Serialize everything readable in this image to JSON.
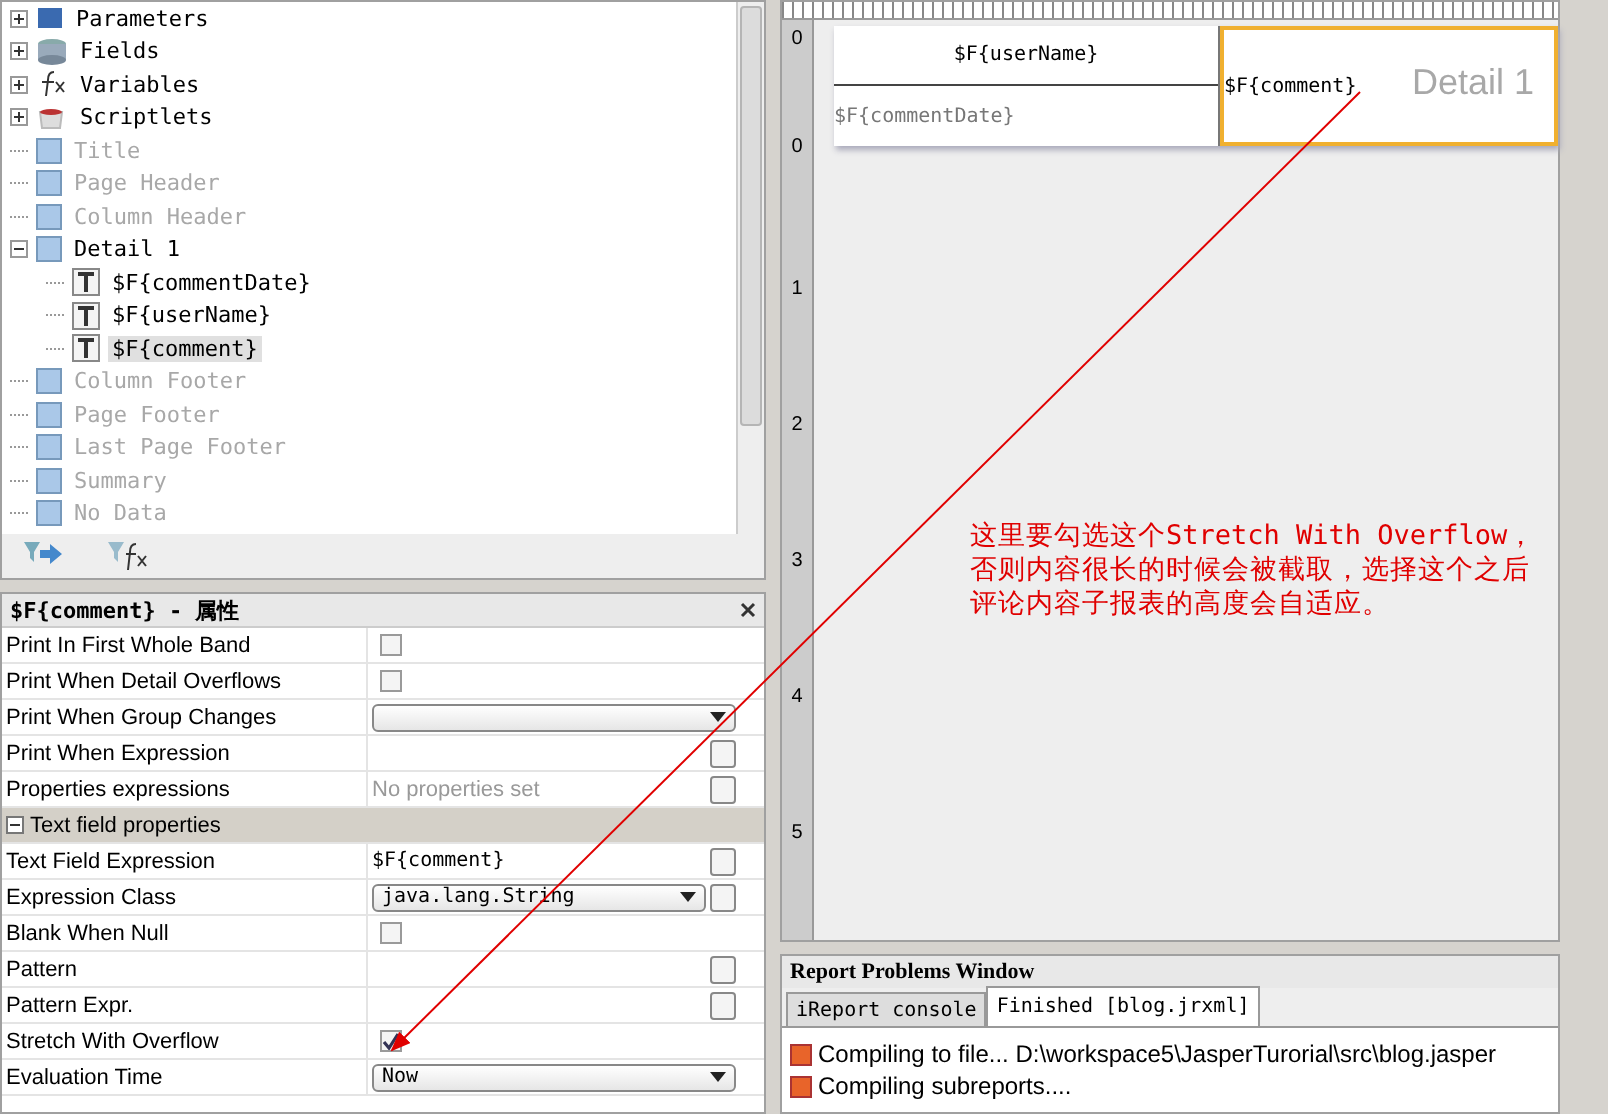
{
  "tree": [
    {
      "label": "Parameters",
      "kind": "parameters",
      "expanded": false,
      "empty": false,
      "selected": false
    },
    {
      "label": "Fields",
      "kind": "fields",
      "expanded": false,
      "empty": false,
      "selected": false
    },
    {
      "label": "Variables",
      "kind": "variables",
      "expanded": false,
      "empty": false,
      "selected": false
    },
    {
      "label": "Scriptlets",
      "kind": "scriptlets",
      "expanded": false,
      "empty": false,
      "selected": false
    },
    {
      "label": "Title",
      "kind": "band",
      "empty": true,
      "selected": false
    },
    {
      "label": "Page Header",
      "kind": "band",
      "empty": true,
      "selected": false
    },
    {
      "label": "Column Header",
      "kind": "band",
      "empty": true,
      "selected": false
    },
    {
      "label": "Detail 1",
      "kind": "band",
      "expanded": true,
      "empty": false,
      "selected": false,
      "children": [
        {
          "label": "$F{commentDate}",
          "kind": "textfield",
          "empty": false,
          "selected": false
        },
        {
          "label": "$F{userName}",
          "kind": "textfield",
          "empty": false,
          "selected": false
        },
        {
          "label": "$F{comment}",
          "kind": "textfield",
          "empty": false,
          "selected": true
        }
      ]
    },
    {
      "label": "Column Footer",
      "kind": "band",
      "empty": true,
      "selected": false
    },
    {
      "label": "Page Footer",
      "kind": "band",
      "empty": true,
      "selected": false
    },
    {
      "label": "Last Page Footer",
      "kind": "band",
      "empty": true,
      "selected": false
    },
    {
      "label": "Summary",
      "kind": "band",
      "empty": true,
      "selected": false
    },
    {
      "label": "No Data",
      "kind": "band",
      "empty": true,
      "selected": false
    }
  ],
  "properties": {
    "title": "$F{comment} - 属性",
    "rows": [
      {
        "kind": "checkbox",
        "label": "Print In First Whole Band",
        "checked": false
      },
      {
        "kind": "checkbox",
        "label": "Print When Detail Overflows",
        "checked": false
      },
      {
        "kind": "dropdown",
        "label": "Print When Group Changes"
      },
      {
        "kind": "expression",
        "label": "Print When Expression"
      },
      {
        "kind": "expression",
        "label": "Properties expressions",
        "summary": "No properties set"
      },
      {
        "kind": "section",
        "label": "Text field properties",
        "expanded": true
      },
      {
        "kind": "expression",
        "label": "Text Field Expression",
        "value": "$F{comment}"
      },
      {
        "kind": "dropdown",
        "label": "Expression Class",
        "value": "java.lang.String",
        "more": true
      },
      {
        "kind": "checkbox",
        "label": "Blank When Null",
        "checked": false
      },
      {
        "kind": "expression",
        "label": "Pattern"
      },
      {
        "kind": "expression",
        "label": "Pattern Expr."
      },
      {
        "kind": "checkbox",
        "label": "Stretch With Overflow",
        "checked": true
      },
      {
        "kind": "dropdown",
        "label": "Evaluation Time",
        "value": "Now"
      }
    ]
  },
  "designer": {
    "ruler_labels": [
      "0",
      "0",
      "1",
      "2",
      "3",
      "4",
      "5"
    ],
    "fields": {
      "user_name": "$F{userName}",
      "comment_date": "$F{commentDate}",
      "comment": "$F{comment}"
    },
    "band_label": "Detail 1",
    "annotation": "这里要勾选这个Stretch With Overflow，否则内容很长的时候会被截取，选择这个之后评论内容子报表的高度会自适应。"
  },
  "problems": {
    "title": "Report Problems Window",
    "tabs": [
      {
        "label": "iReport console",
        "selected": false
      },
      {
        "label": "Finished [blog.jrxml]",
        "selected": true
      }
    ],
    "lines": [
      "Compiling to file... D:\\workspace5\\JasperTurorial\\src\\blog.jasper",
      "Compiling subreports...."
    ]
  }
}
